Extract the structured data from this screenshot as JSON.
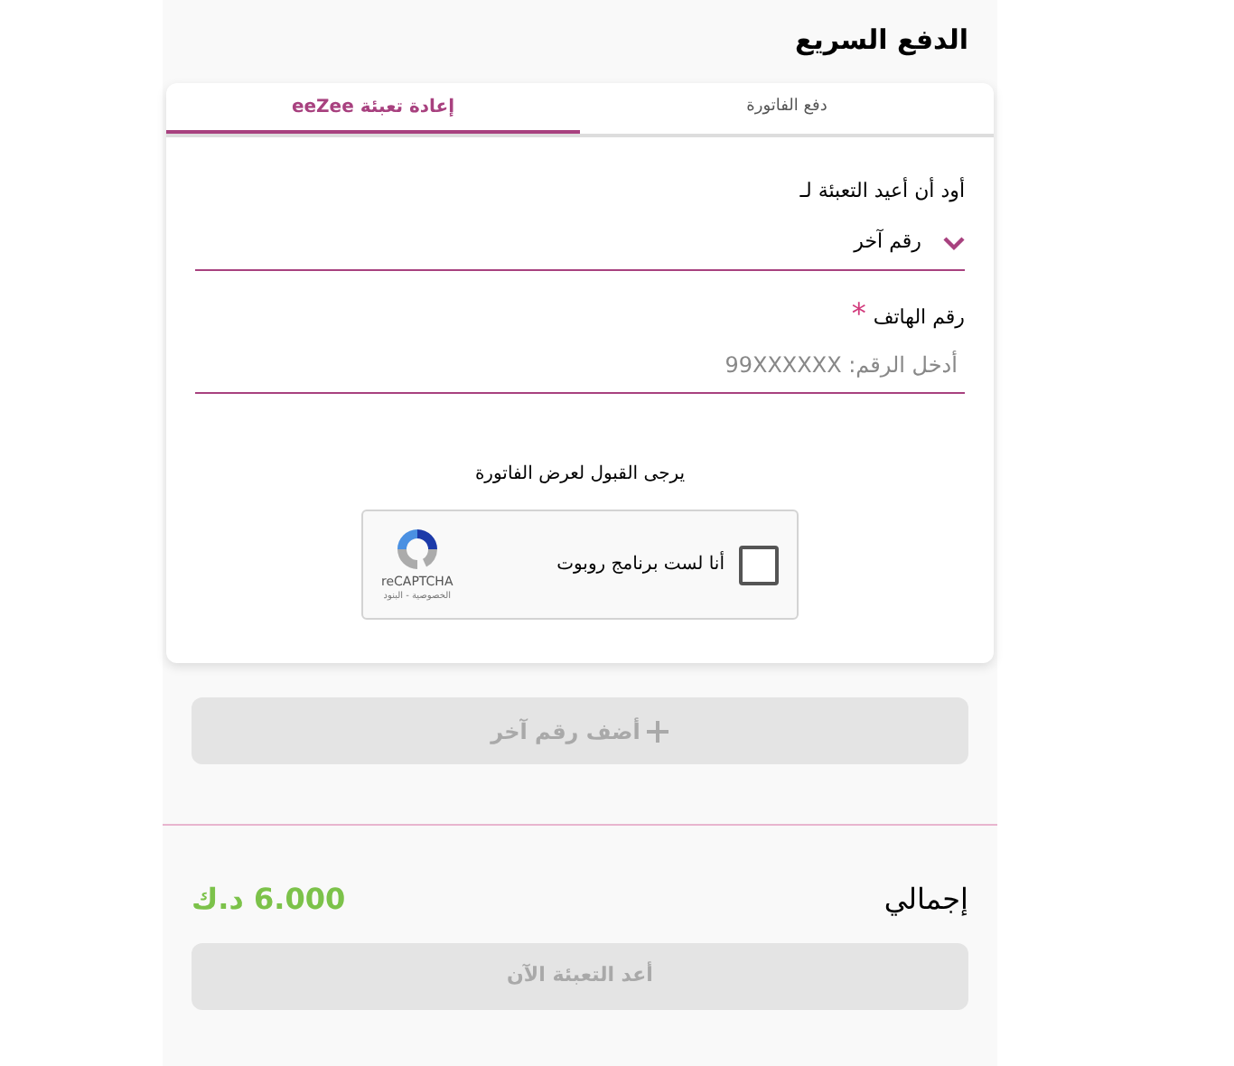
{
  "title": "الدفع السريع",
  "tabs": [
    {
      "label": "دفع الفاتورة",
      "selected": false
    },
    {
      "label": "إعادة تعبئة eeZee",
      "selected": true
    }
  ],
  "recharge_for": {
    "label": "أود أن أعيد التعبئة لـ",
    "value": "رقم آخر"
  },
  "phone": {
    "label": "رقم الهاتف",
    "required_mark": "*",
    "placeholder": "أدخل الرقم: 99XXXXXX"
  },
  "consent": "يرجى القبول لعرض الفاتورة",
  "captcha": {
    "label": "أنا لست برنامج روبوت",
    "checked": false,
    "brand": "reCAPTCHA",
    "links": "الخصوصية - البنود"
  },
  "add_button": {
    "label": "أضف رقم آخر",
    "disabled": true
  },
  "total": {
    "label": "إجمالي",
    "amount": "6.000 د.ك"
  },
  "submit_button": {
    "label": "أعد التعبئة الآن",
    "disabled": true
  }
}
